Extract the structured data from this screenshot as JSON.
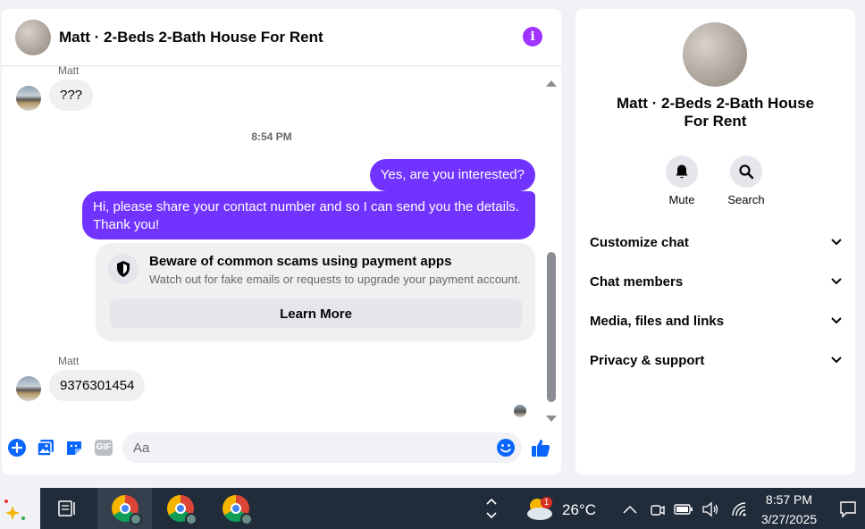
{
  "chat": {
    "title": "Matt · 2-Beds 2-Bath House For Rent",
    "info_icon": "i",
    "messages": [
      {
        "sender": "Matt",
        "text": "???"
      },
      {
        "timestamp": "8:54 PM"
      },
      {
        "text": "Yes, are you interested?"
      },
      {
        "text_line1": "Hi, please share your contact number and so I can send you the details.",
        "text_line2": "Thank you!"
      },
      {
        "sender": "Matt",
        "text": "9376301454"
      }
    ],
    "scam_notice": {
      "title": "Beware of common scams using payment apps",
      "text": "Watch out for fake emails or requests to upgrade your payment account.",
      "button": "Learn More"
    },
    "composer": {
      "placeholder": "Aa",
      "icons": [
        "plus-circle-icon",
        "photo-icon",
        "sticker-icon",
        "gif-icon",
        "emoji-icon",
        "like-icon"
      ],
      "gif_label": "GIF"
    },
    "accent_color": "#7133ff"
  },
  "info_panel": {
    "title": "Matt · 2-Beds 2-Bath House For Rent",
    "actions": [
      {
        "label": "Mute",
        "icon": "bell-icon"
      },
      {
        "label": "Search",
        "icon": "search-icon"
      }
    ],
    "sections": [
      "Customize chat",
      "Chat members",
      "Media, files and links",
      "Privacy & support"
    ]
  },
  "taskbar": {
    "weather_temp": "26°C",
    "weather_badge": "1",
    "time": "8:57 PM",
    "date": "3/27/2025"
  }
}
